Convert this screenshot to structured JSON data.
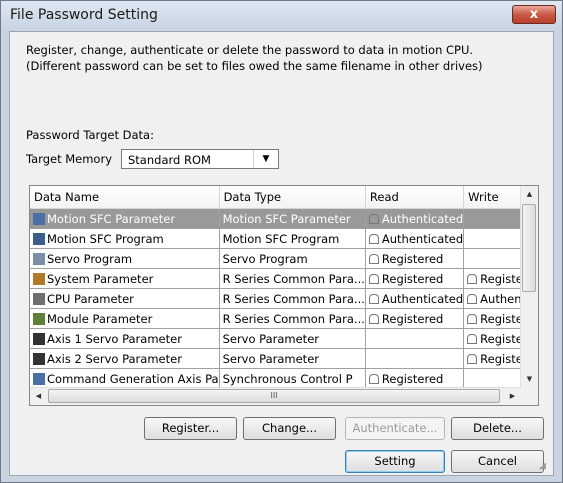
{
  "window": {
    "title": "File Password Setting",
    "close_label": "x"
  },
  "description": {
    "line1": "Register, change, authenticate or delete the password to data in motion CPU.",
    "line2": "(Different password can be set to files owed the same filename in other drives)"
  },
  "target": {
    "section_label": "Password Target Data:",
    "memory_label": "Target Memory",
    "memory_value": "Standard ROM"
  },
  "table": {
    "columns": [
      "Data Name",
      "Data Type",
      "Read",
      "Write"
    ],
    "rows": [
      {
        "name": "Motion SFC Parameter",
        "type": "Motion SFC Parameter",
        "read": "Authenticated",
        "write": "",
        "selected": true
      },
      {
        "name": "Motion SFC Program",
        "type": "Motion SFC Program",
        "read": "Authenticated",
        "write": ""
      },
      {
        "name": "Servo Program",
        "type": "Servo Program",
        "read": "Registered",
        "write": ""
      },
      {
        "name": "System Parameter",
        "type": "R Series Common Para...",
        "read": "Registered",
        "write": "Registered"
      },
      {
        "name": "CPU Parameter",
        "type": "R Series Common Para...",
        "read": "Authenticated",
        "write": "Authenticat"
      },
      {
        "name": "Module Parameter",
        "type": "R Series Common Para...",
        "read": "Registered",
        "write": "Registered"
      },
      {
        "name": "Axis 1 Servo Parameter",
        "type": "Servo Parameter",
        "read": "",
        "write": "Registered"
      },
      {
        "name": "Axis 2 Servo Parameter",
        "type": "Servo Parameter",
        "read": "",
        "write": "Registered"
      },
      {
        "name": "Command Generation Axis Pa",
        "type": "Synchronous Control P",
        "read": "Registered",
        "write": ""
      }
    ],
    "hscroll_grip": "III"
  },
  "buttons": {
    "register": "Register...",
    "change": "Change...",
    "authenticate": "Authenticate...",
    "delete": "Delete...",
    "setting": "Setting",
    "cancel": "Cancel"
  }
}
